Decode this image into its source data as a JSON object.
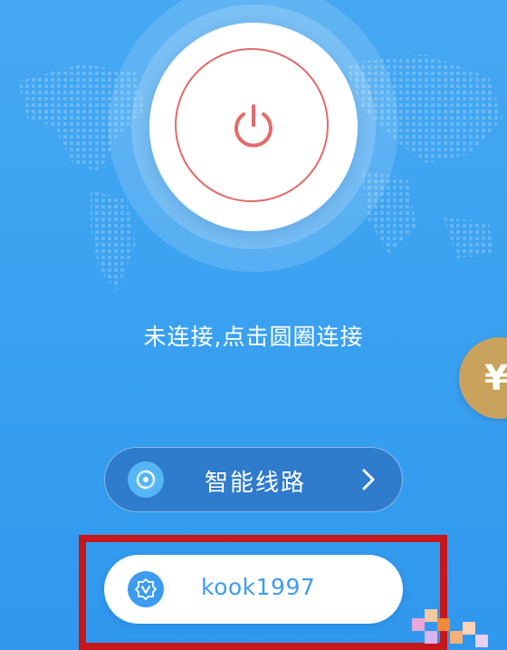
{
  "power": {
    "state_text": "未连接,点击圆圈连接",
    "ring_color": "#e26b6b",
    "icon": "power-icon"
  },
  "route": {
    "label": "智能线路",
    "icon": "route-swirl-icon",
    "chevron_icon": "chevron-right-icon"
  },
  "account": {
    "username": "kook1997",
    "icon": "vip-badge-icon"
  },
  "coin": {
    "symbol": "¥",
    "color": "#c9a35e"
  },
  "colors": {
    "background": "#3ba2f1",
    "highlight": "#c8161d",
    "accent": "#3d9cf0"
  }
}
